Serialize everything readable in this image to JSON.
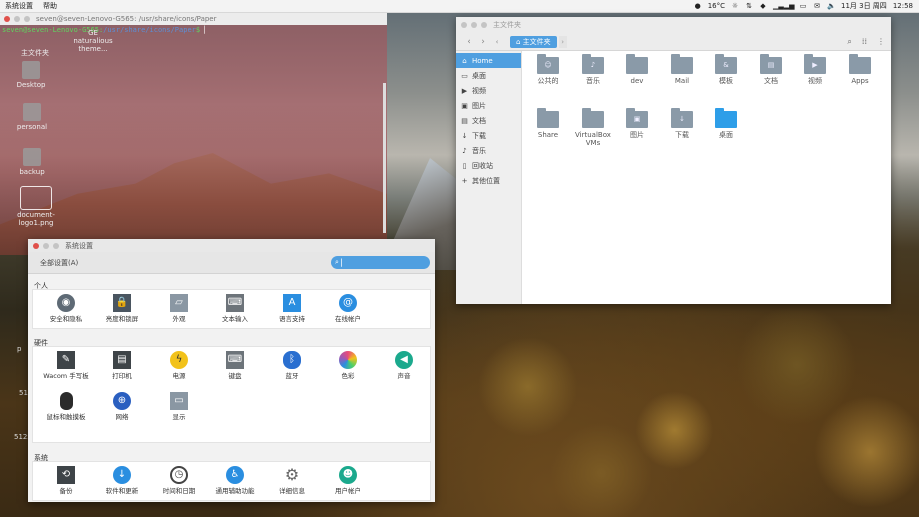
{
  "topbar": {
    "menus": [
      "系统设置",
      "帮助"
    ],
    "temperature": "16°C",
    "datetime": "11月 3日 周四",
    "time": "12:58"
  },
  "terminal": {
    "title": "seven@seven-Lenovo-G565: /usr/share/icons/Paper",
    "prompt_user": "seven@seven-Lenovo-G565",
    "prompt_path": "/usr/share/icons/Paper",
    "prompt_suffix": "$"
  },
  "desktop": {
    "icons": [
      {
        "label": "主文件夹"
      },
      {
        "label": "Desktop"
      },
      {
        "label": "personal"
      },
      {
        "label": "backup"
      },
      {
        "label": "document-logo1.png"
      }
    ],
    "overlay_labels": [
      "GE",
      "naturalious theme..."
    ],
    "edge_labels": [
      "p",
      "51",
      "512x"
    ]
  },
  "filemanager": {
    "title": "主文件夹",
    "crumb": "主文件夹",
    "sidebar": [
      {
        "label": "Home",
        "icon": "home-icon"
      },
      {
        "label": "桌面",
        "icon": "desktop-icon"
      },
      {
        "label": "视频",
        "icon": "video-icon"
      },
      {
        "label": "图片",
        "icon": "image-icon"
      },
      {
        "label": "文档",
        "icon": "document-icon"
      },
      {
        "label": "下载",
        "icon": "download-icon"
      },
      {
        "label": "音乐",
        "icon": "music-icon"
      },
      {
        "label": "回收站",
        "icon": "trash-icon"
      },
      {
        "label": "其他位置",
        "icon": "plus-icon"
      }
    ],
    "files": [
      {
        "label": "公共的"
      },
      {
        "label": "音乐"
      },
      {
        "label": "dev"
      },
      {
        "label": "Mail"
      },
      {
        "label": "模板"
      },
      {
        "label": "文档"
      },
      {
        "label": "视频"
      },
      {
        "label": "Apps"
      },
      {
        "label": "Share"
      },
      {
        "label": "VirtualBox VMs"
      },
      {
        "label": "图片"
      },
      {
        "label": "下载"
      },
      {
        "label": "桌面"
      }
    ]
  },
  "settings": {
    "title": "系统设置",
    "all_settings": "全部设置(A)",
    "search_placeholder": "",
    "sections": {
      "personal": "个人",
      "hardware": "硬件",
      "system": "系统"
    },
    "personal_items": [
      {
        "label": "安全和隐私",
        "color": "#5e6a75"
      },
      {
        "label": "亮度和锁屏",
        "color": "#4a5560"
      },
      {
        "label": "外观",
        "color": "#8a97a3"
      },
      {
        "label": "文本输入",
        "color": "#6d747a"
      },
      {
        "label": "语言支持",
        "color": "#2a8ee0"
      },
      {
        "label": "在线帐户",
        "color": "#2a8ee0"
      }
    ],
    "hardware_items": [
      {
        "label": "Wacom 手写板",
        "color": "#3e4448"
      },
      {
        "label": "打印机",
        "color": "#3e4448"
      },
      {
        "label": "电源",
        "color": "#f2c21a"
      },
      {
        "label": "键盘",
        "color": "#6d747a"
      },
      {
        "label": "蓝牙",
        "color": "#2a6fd0"
      },
      {
        "label": "色彩",
        "color": "#e94b7a"
      },
      {
        "label": "声音",
        "color": "#1ba98d"
      },
      {
        "label": "鼠标和触摸板",
        "color": "#2b2b2b"
      },
      {
        "label": "网络",
        "color": "#2a5fc0"
      },
      {
        "label": "显示",
        "color": "#8a97a3"
      }
    ],
    "system_items": [
      {
        "label": "备份",
        "color": "#3e4448"
      },
      {
        "label": "软件和更新",
        "color": "#2a8ee0"
      },
      {
        "label": "时间和日期",
        "color": "#444"
      },
      {
        "label": "通用辅助功能",
        "color": "#2a8ee0"
      },
      {
        "label": "详细信息",
        "color": "#666"
      },
      {
        "label": "用户帐户",
        "color": "#1ba98d"
      }
    ]
  }
}
